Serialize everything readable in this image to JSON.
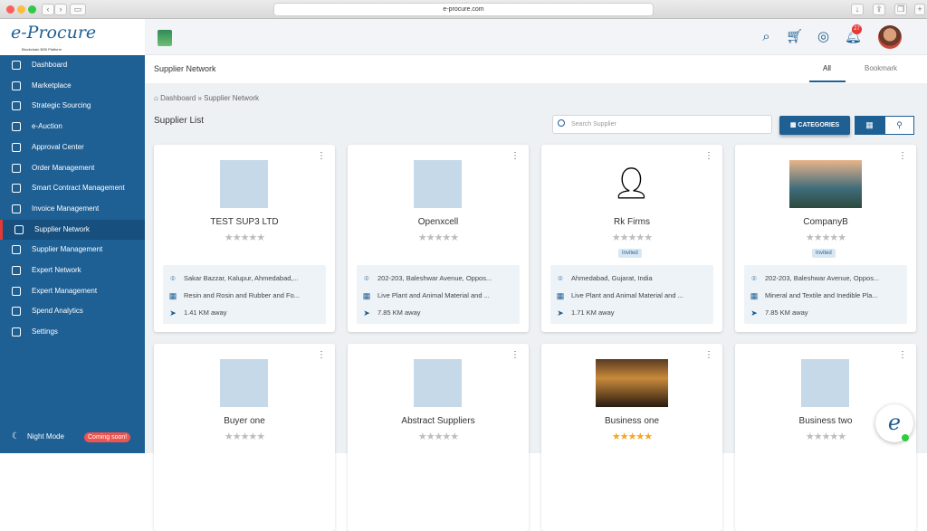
{
  "browser": {
    "url": "e-procure.com"
  },
  "logo": {
    "text": "e-Procure",
    "tagline": "Blockchain B2B Platform"
  },
  "sidebar": {
    "items": [
      {
        "label": "Dashboard"
      },
      {
        "label": "Marketplace"
      },
      {
        "label": "Strategic Sourcing"
      },
      {
        "label": "e-Auction"
      },
      {
        "label": "Approval Center"
      },
      {
        "label": "Order Management"
      },
      {
        "label": "Smart Contract Management"
      },
      {
        "label": "Invoice Management"
      },
      {
        "label": "Supplier Network"
      },
      {
        "label": "Supplier Management"
      },
      {
        "label": "Expert Network"
      },
      {
        "label": "Expert Management"
      },
      {
        "label": "Spend Analytics"
      },
      {
        "label": "Settings"
      }
    ],
    "active_index": 8,
    "night_mode": {
      "label": "Night Mode",
      "badge": "Coming soon!"
    }
  },
  "topbar": {
    "notification_count": "27"
  },
  "page": {
    "title": "Supplier Network",
    "tabs": [
      {
        "label": "All"
      },
      {
        "label": "Bookmark"
      }
    ],
    "breadcrumb": {
      "home": "Dashboard",
      "sep": "»",
      "current": "Supplier Network"
    },
    "section_title": "Supplier List",
    "search_placeholder": "Search Supplier",
    "categories_label": "CATEGORIES"
  },
  "suppliers": [
    {
      "name": "TEST SUP3 LTD",
      "rating": 0,
      "badge": "",
      "address": "Sakar Bazzar, Kalupur, Ahmedabad,...",
      "category": "Resin and Rosin and Rubber and Fo...",
      "distance": "1.41 KM away"
    },
    {
      "name": "Openxcell",
      "rating": 0,
      "badge": "",
      "address": "202-203, Baleshwar Avenue, Oppos...",
      "category": "Live Plant and Animal Material and ...",
      "distance": "7.85 KM away"
    },
    {
      "name": "Rk Firms",
      "rating": 0,
      "badge": "Invited",
      "address": "Ahmedabad, Gujarat, India",
      "category": "Live Plant and Animal Material and ...",
      "distance": "1.71 KM away"
    },
    {
      "name": "CompanyB",
      "rating": 0,
      "badge": "Invited",
      "address": "202-203, Baleshwar Avenue, Oppos...",
      "category": "Mineral and Textile and Inedible Pla...",
      "distance": "7.85 KM away"
    },
    {
      "name": "Buyer one",
      "rating": 0
    },
    {
      "name": "Abstract Suppliers",
      "rating": 0
    },
    {
      "name": "Business one",
      "rating": 5
    },
    {
      "name": "Business two",
      "rating": 0
    }
  ]
}
